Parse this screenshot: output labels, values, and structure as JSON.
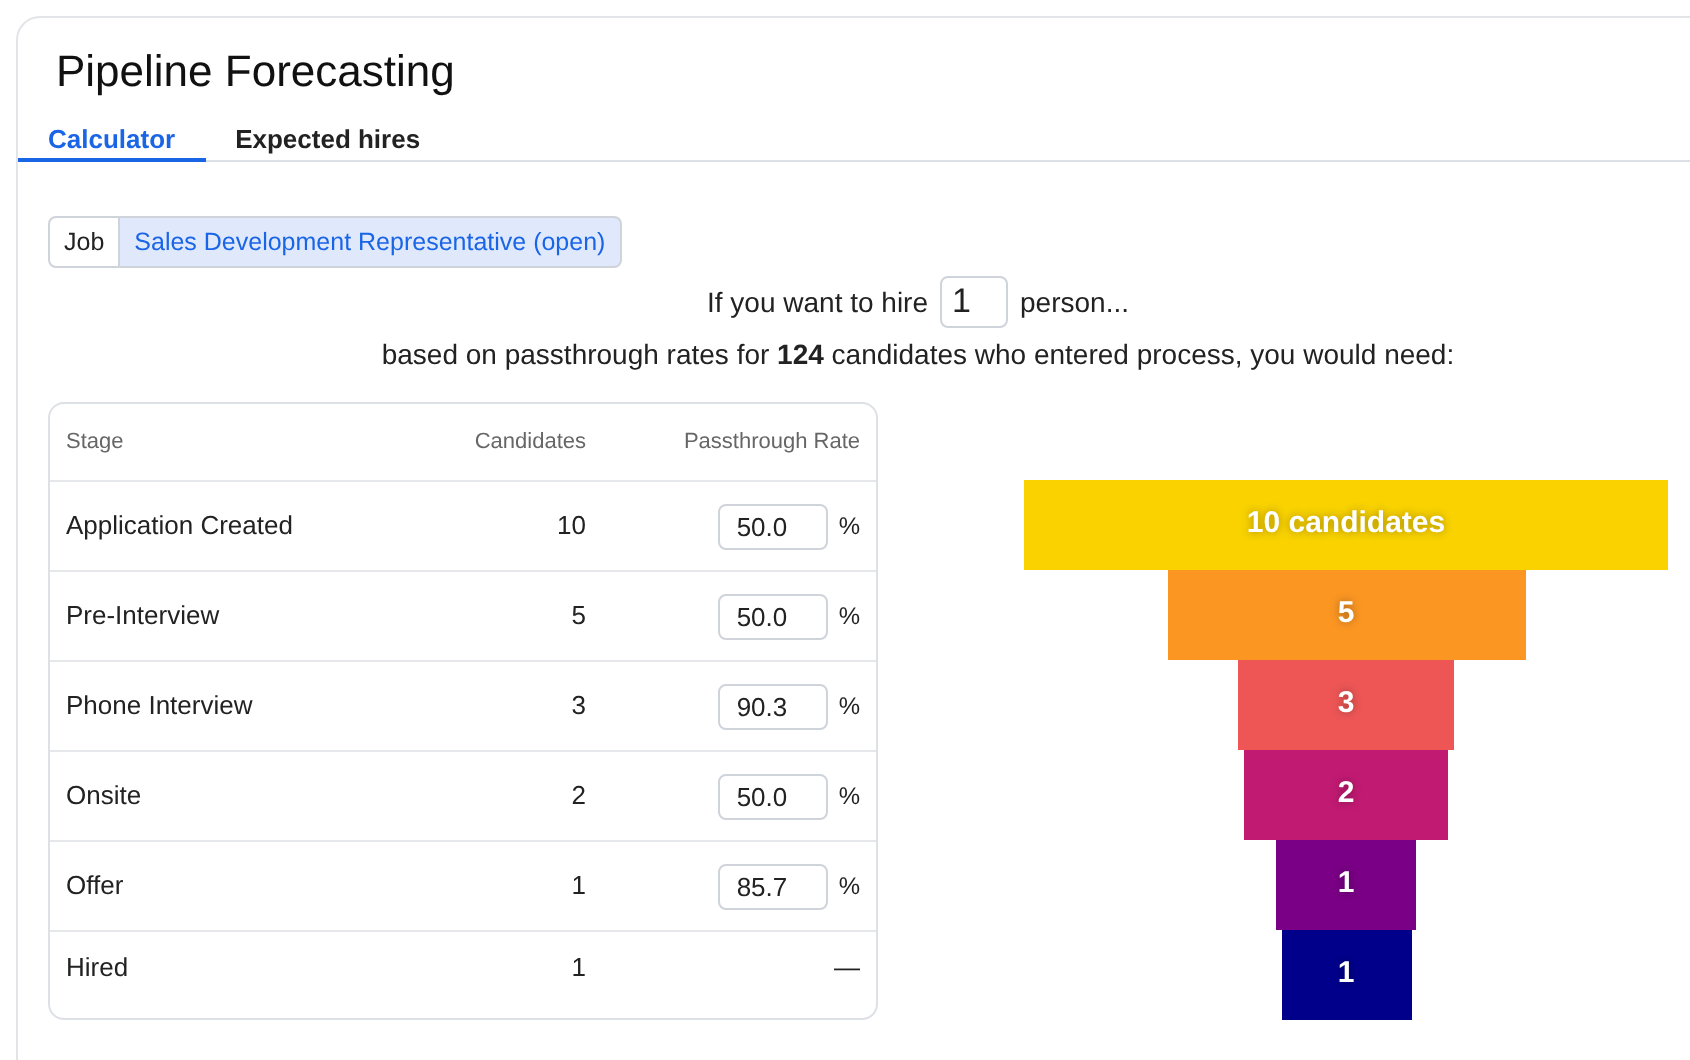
{
  "title": "Pipeline Forecasting",
  "tabs": [
    {
      "label": "Calculator",
      "selected": true
    },
    {
      "label": "Expected hires",
      "selected": false
    }
  ],
  "job": {
    "label": "Job",
    "value": "Sales Development Representative (open)"
  },
  "hire_prompt": {
    "before": "If you want to hire",
    "value": "1",
    "after": "person..."
  },
  "summary": "based on passthrough rates for **124** candidates who entered process, you would need:",
  "table": {
    "columns": [
      "Stage",
      "Candidates",
      "Passthrough Rate"
    ],
    "rows": [
      {
        "stage": "Application Created",
        "candidates": "10",
        "rate": "50.0",
        "unit": "%"
      },
      {
        "stage": "Pre-Interview",
        "candidates": "5",
        "rate": "50.0",
        "unit": "%"
      },
      {
        "stage": "Phone Interview",
        "candidates": "3",
        "rate": "90.3",
        "unit": "%"
      },
      {
        "stage": "Onsite",
        "candidates": "2",
        "rate": "50.0",
        "unit": "%"
      },
      {
        "stage": "Offer",
        "candidates": "1",
        "rate": "85.7",
        "unit": "%"
      },
      {
        "stage": "Hired",
        "candidates": "1",
        "rate_text": "—"
      }
    ]
  },
  "funnel": [
    {
      "label": "10 candidates",
      "color": "#f9d200"
    },
    {
      "label": "5",
      "color": "#fb9623"
    },
    {
      "label": "3",
      "color": "#ee5656"
    },
    {
      "label": "2",
      "color": "#c11a72"
    },
    {
      "label": "1",
      "color": "#7a0085"
    },
    {
      "label": "1",
      "color": "#00008b"
    }
  ]
}
